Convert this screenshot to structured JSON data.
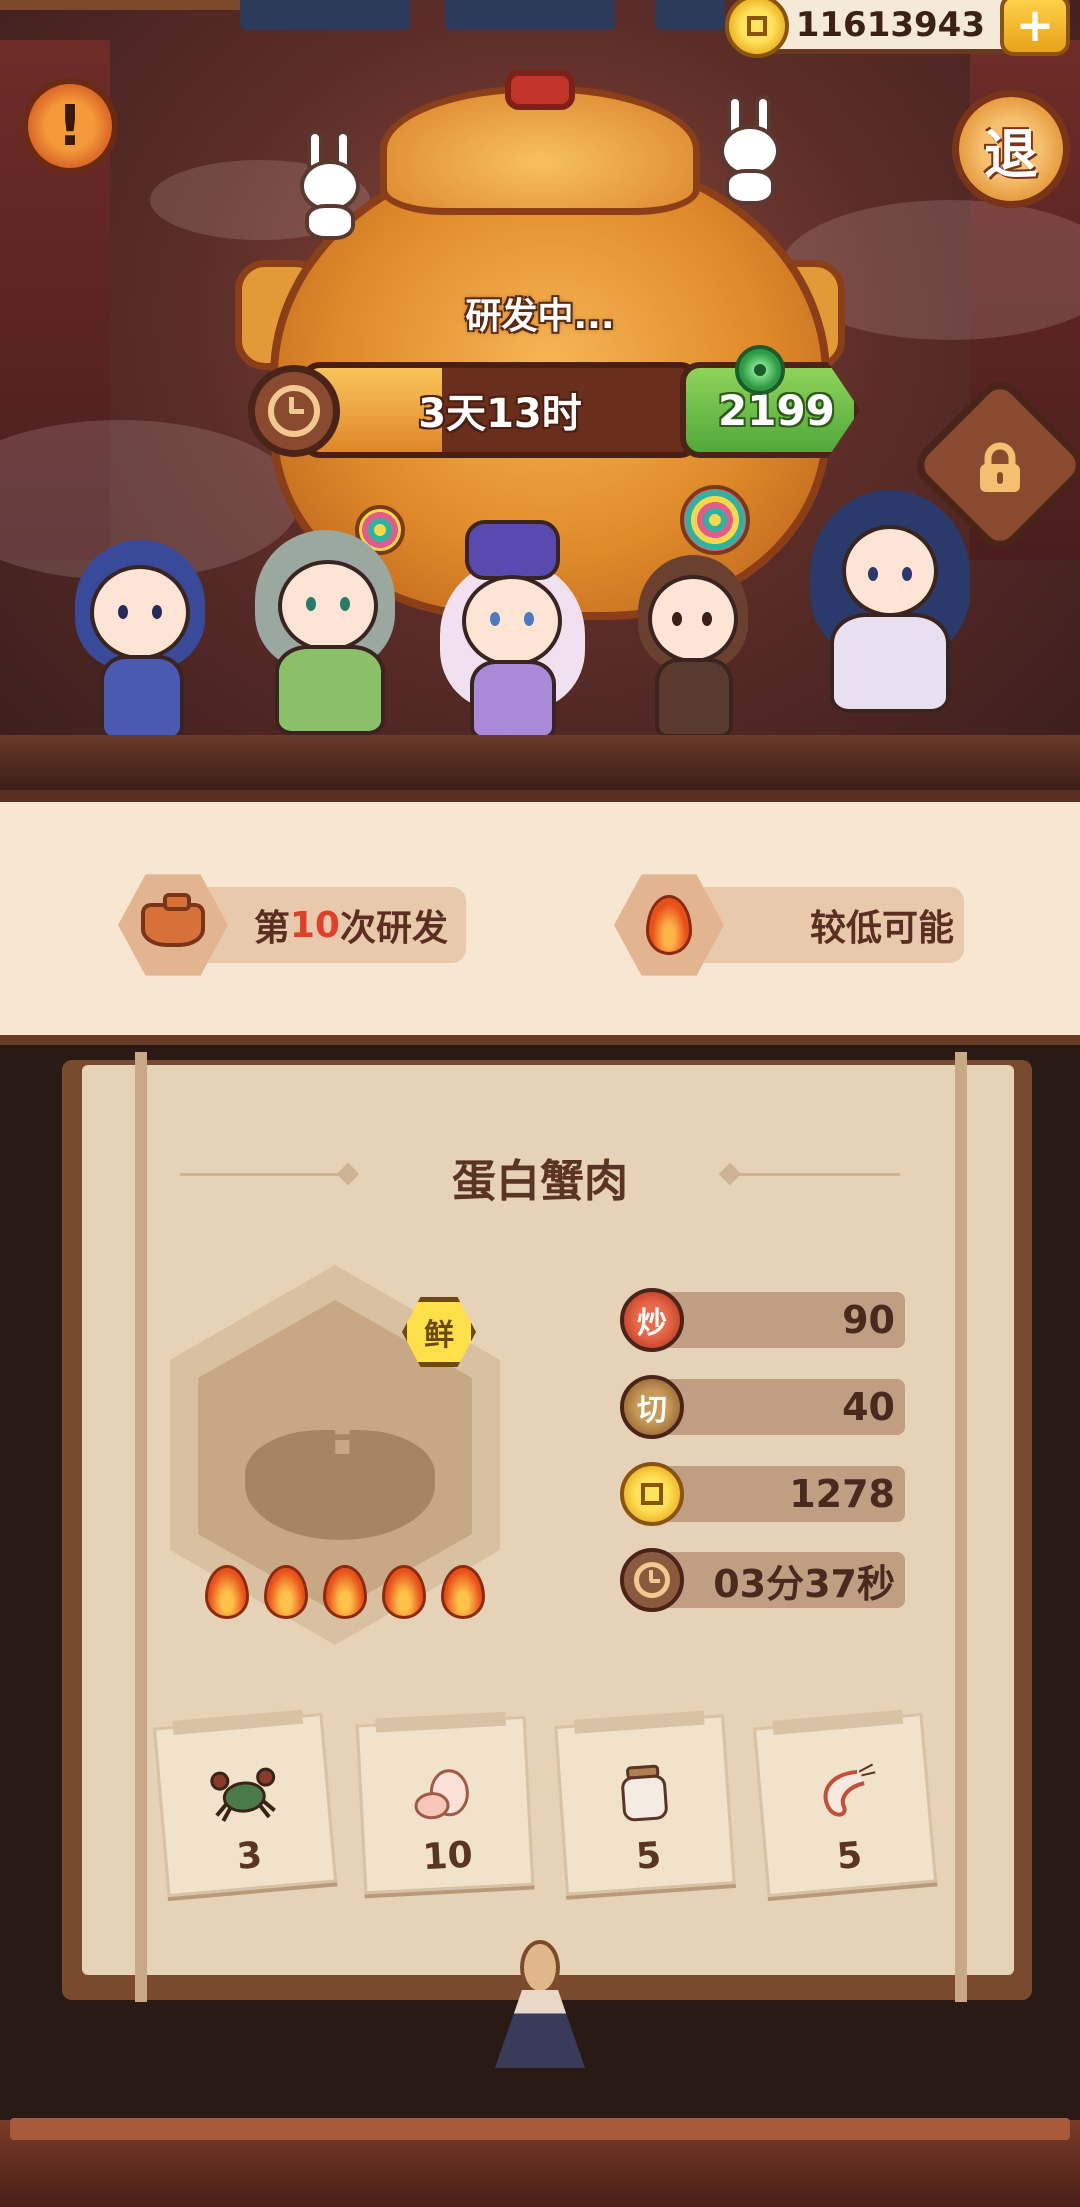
{
  "header": {
    "coins": "11613943",
    "add_label": "+",
    "alert_label": "!",
    "exit_label": "退"
  },
  "research": {
    "status": "研发中...",
    "time_left": "3天13时",
    "progress": 0.35,
    "speedup_cost": "2199"
  },
  "info": {
    "attempt_prefix": "第",
    "attempt_number": "10",
    "attempt_suffix": "次研发",
    "chance": "较低可能"
  },
  "recipe": {
    "name": "蛋白蟹肉",
    "tag": "鲜",
    "mystery_mark": "?",
    "flames": 5,
    "stats": {
      "fry_label": "炒",
      "fry_value": "90",
      "cut_label": "切",
      "cut_value": "40",
      "price_value": "1278",
      "time_value": "03分37秒"
    },
    "ingredients": [
      {
        "icon": "crab-icon",
        "count": "3"
      },
      {
        "icon": "egg-icon",
        "count": "10"
      },
      {
        "icon": "jar-icon",
        "count": "5"
      },
      {
        "icon": "shrimp-icon",
        "count": "5"
      }
    ]
  },
  "colors": {
    "accent_red": "#e0402a",
    "speedup_green": "#4fa83a",
    "panel": "#e6d2b6"
  }
}
